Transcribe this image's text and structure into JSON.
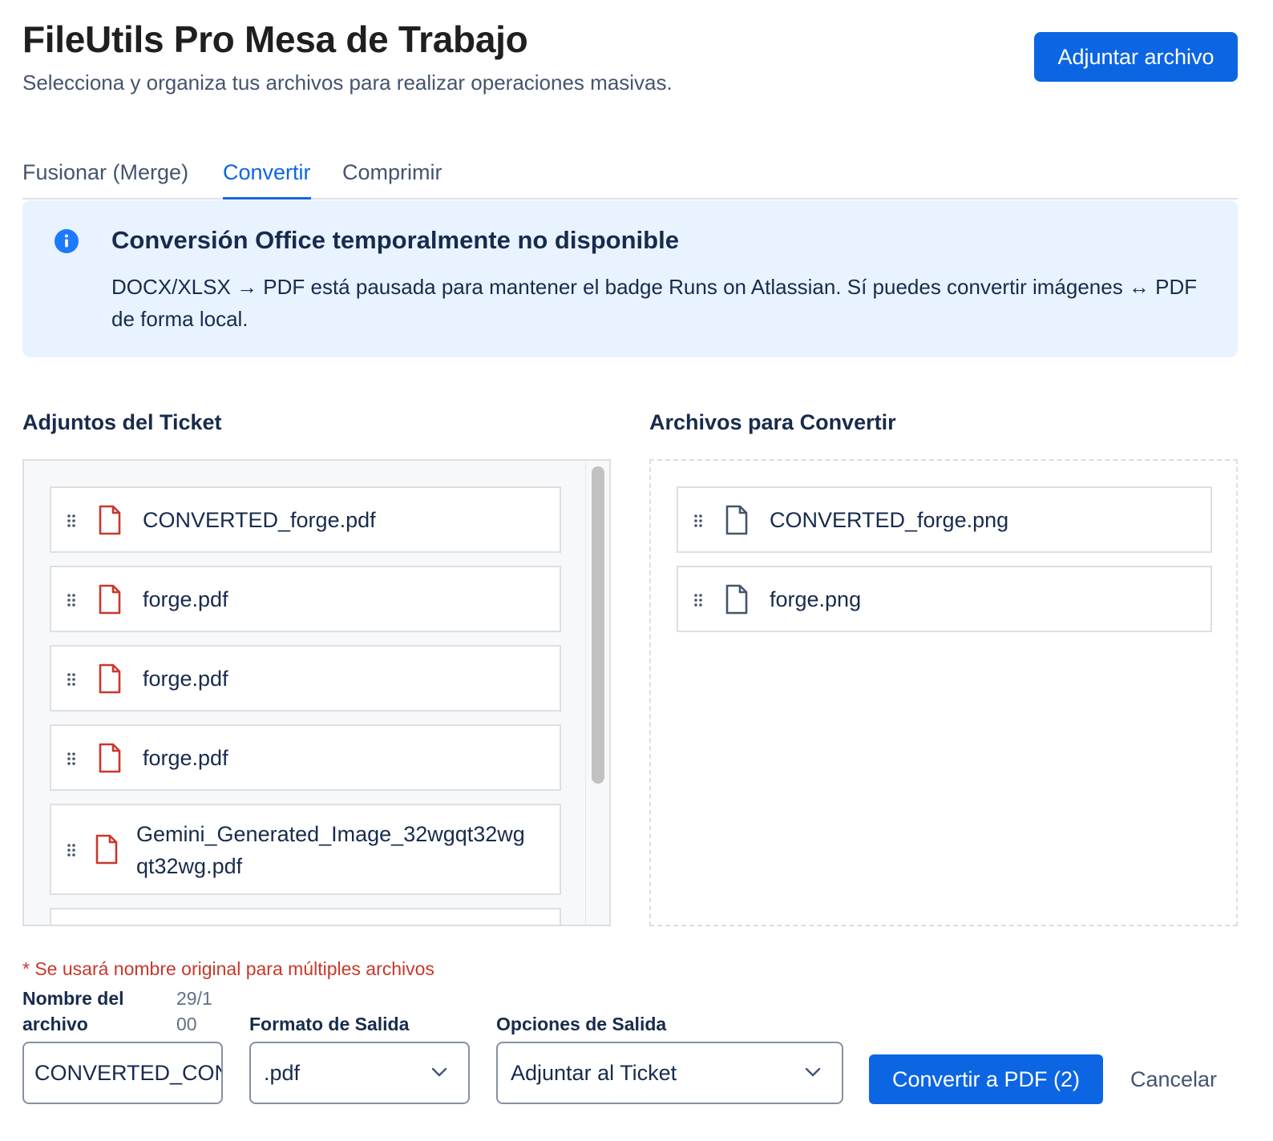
{
  "header": {
    "title": "FileUtils Pro Mesa de Trabajo",
    "subtitle": "Selecciona y organiza tus archivos para realizar operaciones masivas.",
    "attach_label": "Adjuntar archivo"
  },
  "tabs": [
    {
      "label": "Fusionar (Merge)",
      "active": false
    },
    {
      "label": "Convertir",
      "active": true
    },
    {
      "label": "Comprimir",
      "active": false
    }
  ],
  "banner": {
    "icon": "info-icon",
    "title": "Conversión Office temporalmente no disponible",
    "text": "DOCX/XLSX → PDF está pausada para mantener el badge Runs on Atlassian. Sí puedes convertir imágenes ↔ PDF de forma local."
  },
  "left": {
    "title": "Adjuntos del Ticket",
    "files": [
      {
        "name": "CONVERTED_forge.pdf",
        "type": "pdf"
      },
      {
        "name": "forge.pdf",
        "type": "pdf"
      },
      {
        "name": "forge.pdf",
        "type": "pdf"
      },
      {
        "name": "forge.pdf",
        "type": "pdf"
      },
      {
        "name_line1": "Gemini_Generated_Image_32wgqt32wg",
        "name_line2": "qt32wg.pdf",
        "type": "pdf"
      }
    ]
  },
  "right": {
    "title": "Archivos para Convertir",
    "files": [
      {
        "name": "CONVERTED_forge.png",
        "type": "image"
      },
      {
        "name": "forge.png",
        "type": "image"
      }
    ]
  },
  "form": {
    "note": "* Se usará nombre original para múltiples archivos",
    "name_label_line1": "Nombre del",
    "name_label_line2": "archivo",
    "counter_line1": "29/1",
    "counter_line2": "00",
    "name_value": "CONVERTED_CONVERTED_forge",
    "format_label": "Formato de Salida",
    "format_value": ".pdf",
    "options_label": "Opciones de Salida",
    "options_value": "Adjuntar al Ticket",
    "convert_label": "Convertir a PDF (2)",
    "cancel_label": "Cancelar"
  },
  "colors": {
    "primary": "#0c66e4",
    "pdf_icon": "#c9372c",
    "banner_bg": "#e9f2ff",
    "info": "#1d7afc",
    "error_text": "#c9372c"
  }
}
